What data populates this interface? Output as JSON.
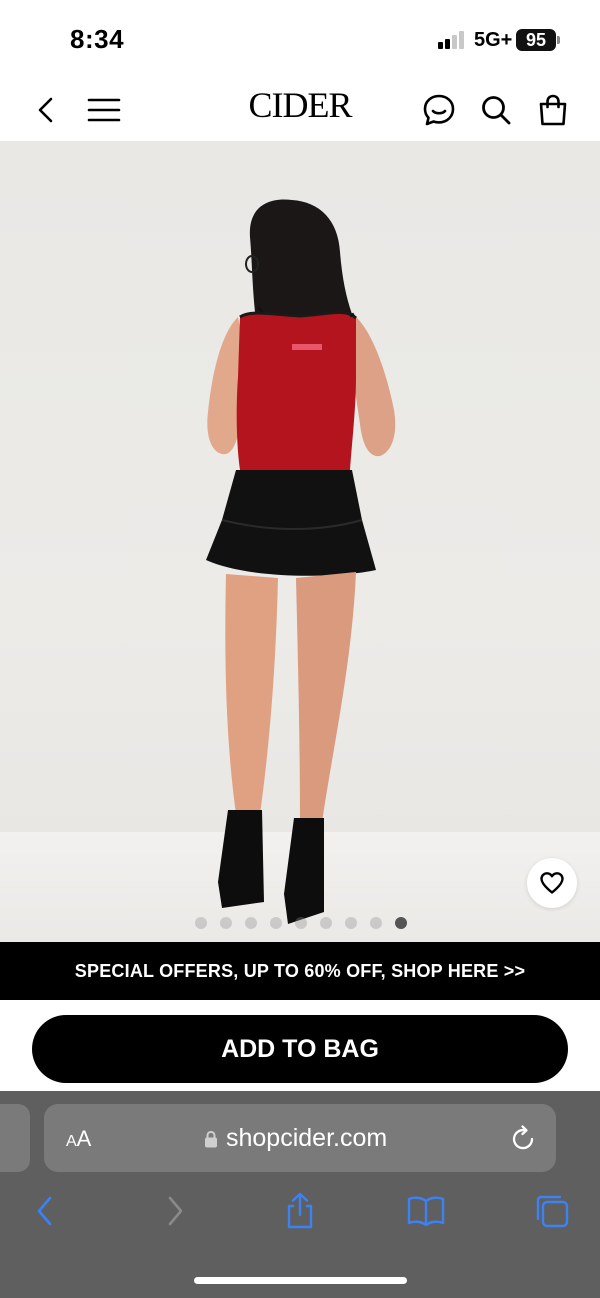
{
  "status_bar": {
    "time": "8:34",
    "network": "5G+",
    "battery": "95"
  },
  "header": {
    "brand": "CIDER"
  },
  "gallery": {
    "image_count": 9,
    "active_index": 8
  },
  "promo": {
    "text": "SPECIAL OFFERS, UP TO 60% OFF, SHOP HERE >>"
  },
  "cta": {
    "add_to_bag": "ADD TO BAG"
  },
  "browser": {
    "text_size_label_small": "A",
    "text_size_label_large": "A",
    "url": "shopcider.com"
  },
  "icons": {
    "back": "chevron-left-icon",
    "menu": "hamburger-icon",
    "chat": "chat-icon",
    "search": "search-icon",
    "bag": "shopping-bag-icon",
    "favorite": "heart-icon",
    "lock": "lock-icon",
    "reload": "reload-icon",
    "browser_back": "chevron-left-icon",
    "browser_forward": "chevron-right-icon",
    "share": "share-icon",
    "bookmarks": "book-icon",
    "tabs": "tabs-icon"
  },
  "colors": {
    "accent_link": "#3b82f6",
    "banner_bg": "#000000"
  }
}
